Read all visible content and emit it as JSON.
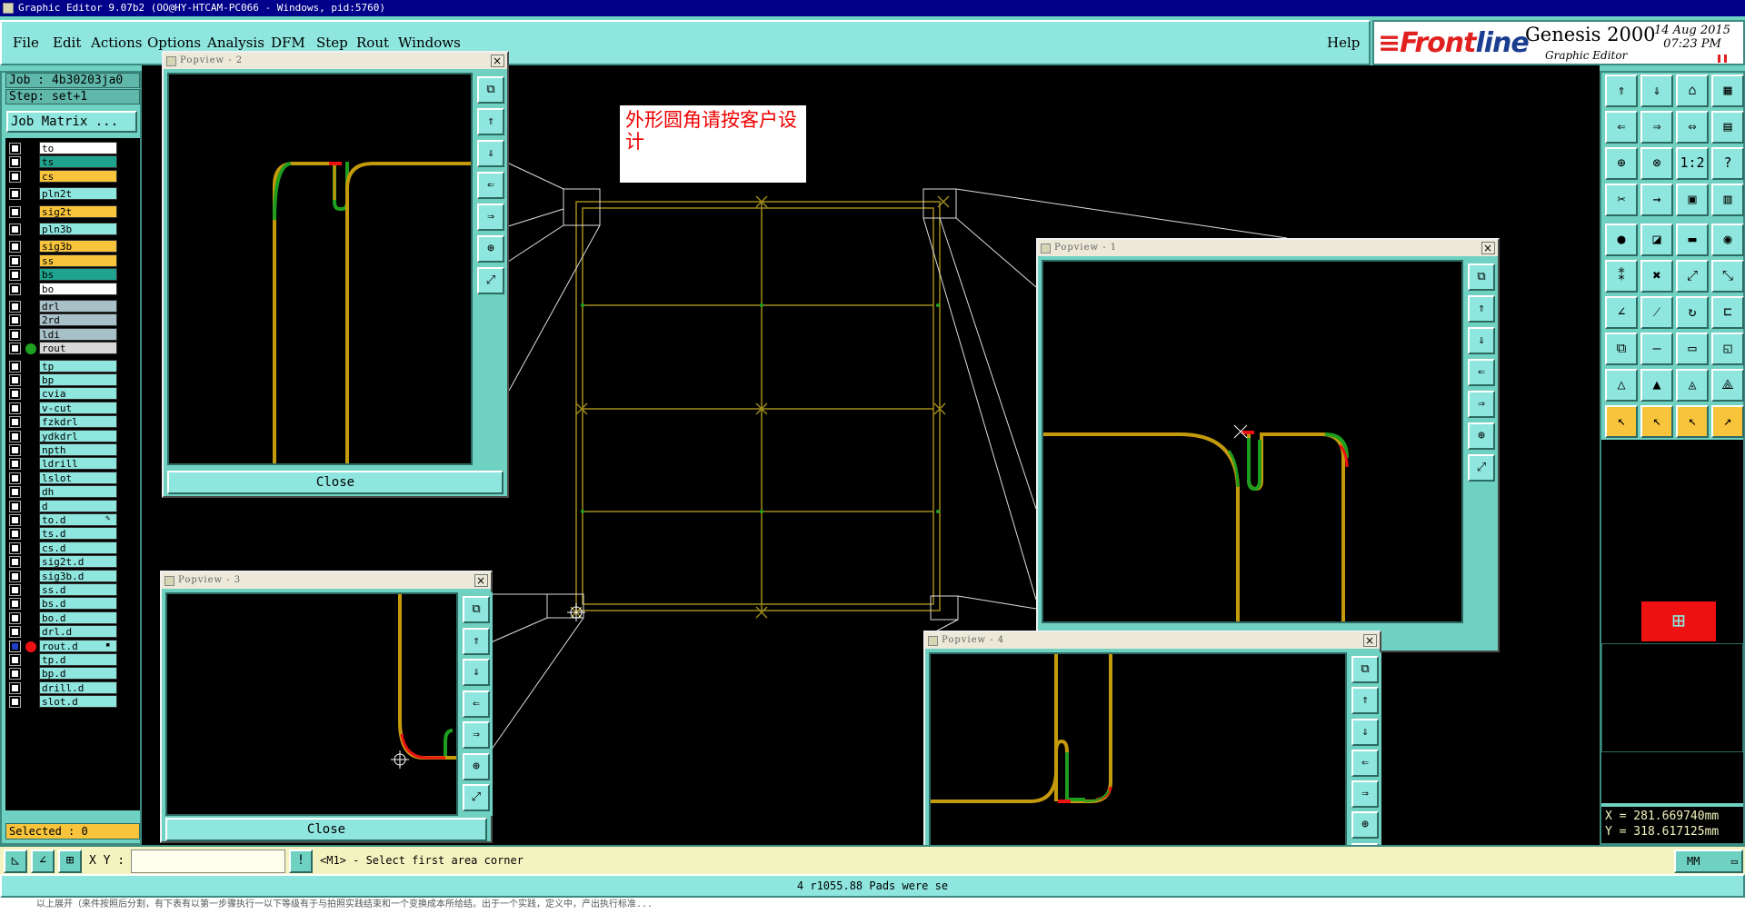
{
  "window": {
    "title": "Graphic Editor 9.07b2 (OO@HY-HTCAM-PC066 - Windows, pid:5760)"
  },
  "menu": [
    "File",
    "Edit",
    "Actions",
    "Options",
    "Analysis",
    "DFM",
    "Step",
    "Rout",
    "Windows"
  ],
  "help": "Help",
  "brand": {
    "logo_a": "≡Front",
    "logo_b": "line",
    "product": "Genesis 2000",
    "subtitle": "Graphic Editor",
    "date": "14 Aug 2015",
    "time": "07:23 PM"
  },
  "job": {
    "job_label": "Job : 4b30203ja0",
    "step_label": "Step: set+1",
    "matrix_button": "Job Matrix ..."
  },
  "layers": [
    {
      "name": "to",
      "color": "#ffffff"
    },
    {
      "name": "ts",
      "color": "#1fa38e"
    },
    {
      "name": "cs",
      "color": "#f7c43c"
    },
    {
      "gap": true
    },
    {
      "name": "pln2t",
      "color": "#8ee6de"
    },
    {
      "gap": true
    },
    {
      "name": "sig2t",
      "color": "#f7c43c"
    },
    {
      "gap": true
    },
    {
      "name": "pln3b",
      "color": "#8ee6de"
    },
    {
      "gap": true
    },
    {
      "name": "sig3b",
      "color": "#f7c43c"
    },
    {
      "name": "ss",
      "color": "#f7c43c"
    },
    {
      "name": "bs",
      "color": "#1fa38e"
    },
    {
      "name": "bo",
      "color": "#ffffff"
    },
    {
      "gap": true
    },
    {
      "name": "drl",
      "color": "#a8c0c8"
    },
    {
      "name": "2rd",
      "color": "#a8c0c8"
    },
    {
      "name": "ldi",
      "color": "#a8c0c8"
    },
    {
      "name": "rout",
      "color": "#d8d8d8",
      "dot": "#21a121"
    },
    {
      "gap": true
    },
    {
      "name": "tp",
      "color": "#8ee6de"
    },
    {
      "name": "bp",
      "color": "#8ee6de"
    },
    {
      "name": "cvia",
      "color": "#8ee6de"
    },
    {
      "name": "v-cut",
      "color": "#8ee6de"
    },
    {
      "name": "fzkdrl",
      "color": "#8ee6de"
    },
    {
      "name": "ydkdrl",
      "color": "#8ee6de"
    },
    {
      "name": "npth",
      "color": "#8ee6de"
    },
    {
      "name": "ldrill",
      "color": "#8ee6de"
    },
    {
      "name": "lslot",
      "color": "#8ee6de"
    },
    {
      "name": "dh",
      "color": "#8ee6de"
    },
    {
      "name": "d",
      "color": "#8ee6de"
    },
    {
      "name": "to.d",
      "color": "#8ee6de",
      "icon": "✎"
    },
    {
      "name": "ts.d",
      "color": "#8ee6de"
    },
    {
      "name": "cs.d",
      "color": "#8ee6de"
    },
    {
      "name": "sig2t.d",
      "color": "#8ee6de"
    },
    {
      "name": "sig3b.d",
      "color": "#8ee6de"
    },
    {
      "name": "ss.d",
      "color": "#8ee6de"
    },
    {
      "name": "bs.d",
      "color": "#8ee6de"
    },
    {
      "name": "bo.d",
      "color": "#8ee6de"
    },
    {
      "name": "drl.d",
      "color": "#8ee6de"
    },
    {
      "name": "rout.d",
      "color": "#8ee6de",
      "dot": "#ee1111",
      "work": true,
      "icon": "▪"
    },
    {
      "name": "tp.d",
      "color": "#8ee6de"
    },
    {
      "name": "bp.d",
      "color": "#8ee6de"
    },
    {
      "name": "drill.d",
      "color": "#8ee6de"
    },
    {
      "name": "slot.d",
      "color": "#8ee6de"
    }
  ],
  "selected": "Selected : 0",
  "note": "外形圆角请按客户设计",
  "popviews": {
    "p1": "Popview - 1",
    "p2": "Popview - 2",
    "p3": "Popview - 3",
    "p4": "Popview - 4",
    "close": "Close",
    "close_icon": "×"
  },
  "command": {
    "xy_label": "X Y :",
    "xy_value": "",
    "message": "<M1> - Select first area corner",
    "units": "MM"
  },
  "coords": {
    "x": "X = 281.669740mm",
    "y": "Y = 318.617125mm"
  },
  "status": "4 r1055.88 Pads were se",
  "bottom": "以上展开（来件按照后分割，有下表有以第一步骤执行一以下等级有于与拍照实践结束和一个变换成本所给结。出于一个实践，定义中，产出执行标准..."
}
